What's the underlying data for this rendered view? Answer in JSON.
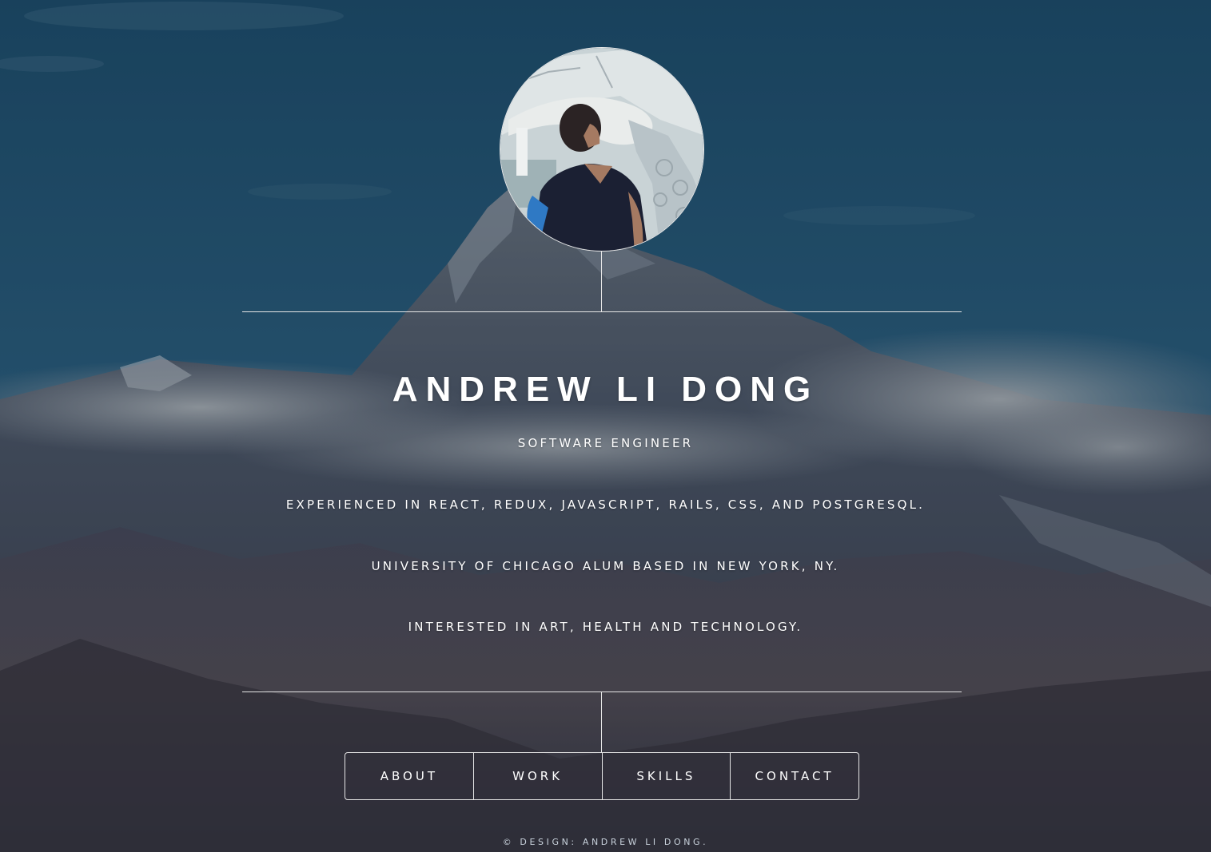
{
  "profile": {
    "avatar_alt": "Profile photo",
    "name": "ANDREW LI DONG",
    "title": "SOFTWARE ENGINEER"
  },
  "bio": [
    "EXPERIENCED IN REACT, REDUX, JAVASCRIPT, RAILS, CSS, AND POSTGRESQL.",
    "UNIVERSITY OF CHICAGO ALUM BASED IN NEW YORK, NY.",
    "INTERESTED IN ART, HEALTH AND TECHNOLOGY."
  ],
  "nav": [
    {
      "label": "ABOUT"
    },
    {
      "label": "WORK"
    },
    {
      "label": "SKILLS"
    },
    {
      "label": "CONTACT"
    }
  ],
  "footer": {
    "text": "© DESIGN: ANDREW LI DONG."
  },
  "colors": {
    "sky": "#20506f",
    "line": "#e6e6e6",
    "text": "#ffffff"
  },
  "icons": {
    "background": "mountain-landscape",
    "avatar": "profile-photo"
  }
}
